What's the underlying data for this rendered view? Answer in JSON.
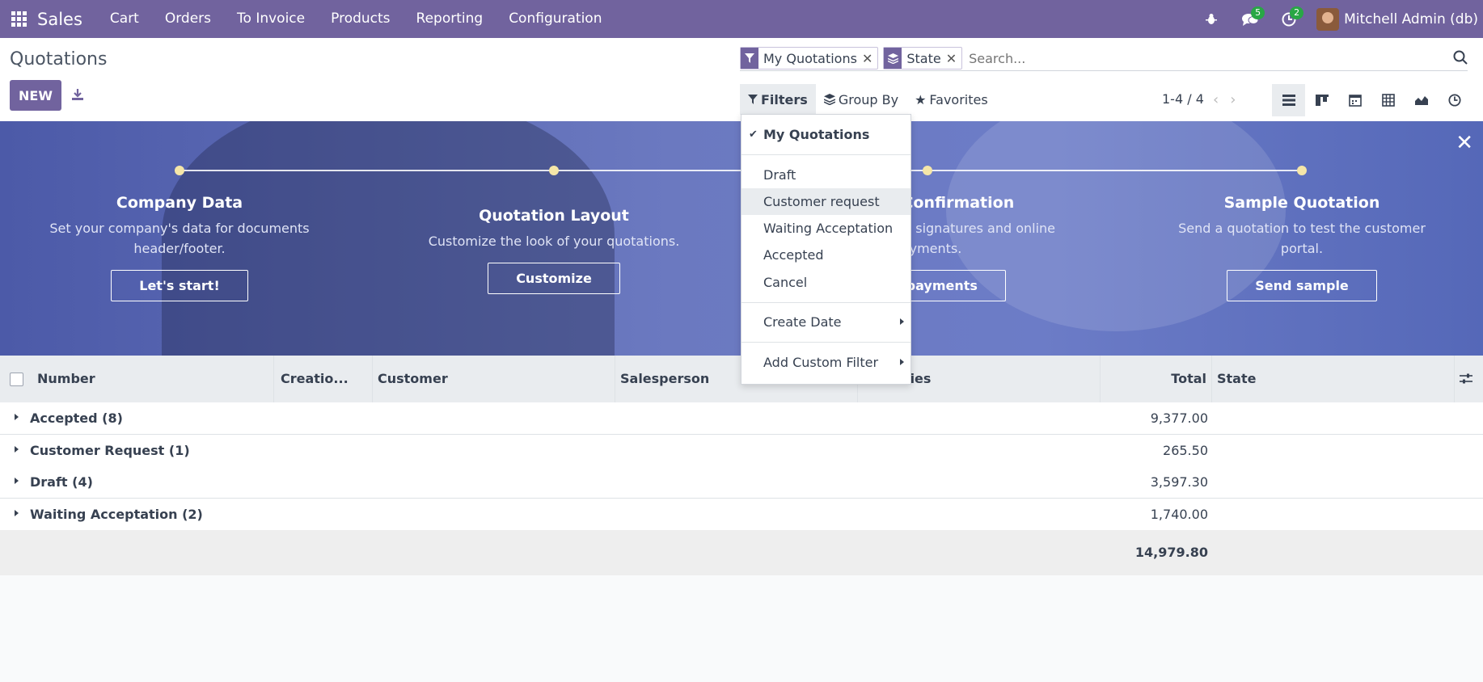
{
  "colors": {
    "brand": "#71639e",
    "badge": "#28a745"
  },
  "topbar": {
    "app_name": "Sales",
    "menu": [
      "Cart",
      "Orders",
      "To Invoice",
      "Products",
      "Reporting",
      "Configuration"
    ],
    "messages_count": "5",
    "activities_count": "2",
    "user_name": "Mitchell Admin (db)"
  },
  "control": {
    "title": "Quotations",
    "new_label": "NEW",
    "facets": [
      {
        "icon": "filter-icon",
        "value": "My Quotations"
      },
      {
        "icon": "layers-icon",
        "value": "State"
      }
    ],
    "search_placeholder": "Search...",
    "filters_label": "Filters",
    "groupby_label": "Group By",
    "favorites_label": "Favorites",
    "pager": "1-4 / 4"
  },
  "banner": {
    "steps": [
      {
        "title": "Company Data",
        "desc": "Set your company's data for documents header/footer.",
        "button": "Let's start!"
      },
      {
        "title": "Quotation Layout",
        "desc": "Customize the look of your quotations.",
        "button": "Customize"
      },
      {
        "title": "Online Confirmation",
        "desc": "Enable electronic signatures and online payments.",
        "button": "Set payments"
      },
      {
        "title": "Sample Quotation",
        "desc": "Send a quotation to test the customer portal.",
        "button": "Send sample"
      }
    ]
  },
  "dropdown": {
    "items": [
      "My Quotations",
      "Draft",
      "Customer request",
      "Waiting Acceptation",
      "Accepted",
      "Cancel",
      "Create Date",
      "Add Custom Filter"
    ]
  },
  "table": {
    "headers": [
      "Number",
      "Creatio...",
      "Customer",
      "Salesperson",
      "Activities",
      "Total",
      "State"
    ],
    "groups": [
      {
        "label": "Accepted (8)",
        "total": "9,377.00"
      },
      {
        "label": "Customer Request (1)",
        "total": "265.50"
      },
      {
        "label": "Draft (4)",
        "total": "3,597.30"
      },
      {
        "label": "Waiting Acceptation (2)",
        "total": "1,740.00"
      }
    ],
    "grand_total": "14,979.80"
  }
}
